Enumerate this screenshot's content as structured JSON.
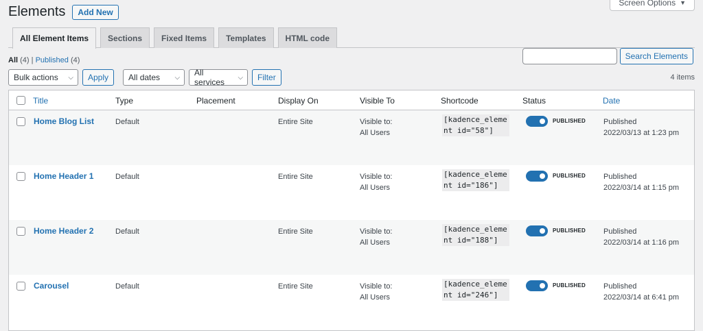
{
  "screen_options": {
    "label": "Screen Options"
  },
  "header": {
    "title": "Elements",
    "add_new": "Add New"
  },
  "tabs": [
    {
      "label": "All Element Items",
      "active": true
    },
    {
      "label": "Sections"
    },
    {
      "label": "Fixed Items"
    },
    {
      "label": "Templates"
    },
    {
      "label": "HTML code"
    }
  ],
  "filters": {
    "all_label": "All",
    "all_count": "(4)",
    "separator": "|",
    "published_label": "Published",
    "published_count": "(4)"
  },
  "search": {
    "placeholder": "",
    "button": "Search Elements"
  },
  "tablenav": {
    "bulk_actions": "Bulk actions",
    "apply": "Apply",
    "dates": "All dates",
    "services": "All services",
    "filter": "Filter",
    "items_count": "4 items"
  },
  "columns": {
    "title": "Title",
    "type": "Type",
    "placement": "Placement",
    "display_on": "Display On",
    "visible_to": "Visible To",
    "shortcode": "Shortcode",
    "status": "Status",
    "date": "Date"
  },
  "rows": [
    {
      "title": "Home Blog List",
      "type": "Default",
      "placement": "",
      "display_on": "Entire Site",
      "visible_to_1": "Visible to:",
      "visible_to_2": "All Users",
      "shortcode": "[kadence_element id=\"58\"]",
      "status": "PUBLISHED",
      "date_status": "Published",
      "date": "2022/03/13 at 1:23 pm"
    },
    {
      "title": "Home Header 1",
      "type": "Default",
      "placement": "",
      "display_on": "Entire Site",
      "visible_to_1": "Visible to:",
      "visible_to_2": "All Users",
      "shortcode": "[kadence_element id=\"186\"]",
      "status": "PUBLISHED",
      "date_status": "Published",
      "date": "2022/03/14 at 1:15 pm"
    },
    {
      "title": "Home Header 2",
      "type": "Default",
      "placement": "",
      "display_on": "Entire Site",
      "visible_to_1": "Visible to:",
      "visible_to_2": "All Users",
      "shortcode": "[kadence_element id=\"188\"]",
      "status": "PUBLISHED",
      "date_status": "Published",
      "date": "2022/03/14 at 1:16 pm"
    },
    {
      "title": "Carousel",
      "type": "Default",
      "placement": "",
      "display_on": "Entire Site",
      "visible_to_1": "Visible to:",
      "visible_to_2": "All Users",
      "shortcode": "[kadence_element id=\"246\"]",
      "status": "PUBLISHED",
      "date_status": "Published",
      "date": "2022/03/14 at 6:41 pm"
    }
  ],
  "colors": {
    "accent": "#2271b1",
    "background": "#f0f0f1"
  },
  "icons": {
    "dropdown": "caret-down-icon",
    "select": "chevron-down-icon"
  }
}
